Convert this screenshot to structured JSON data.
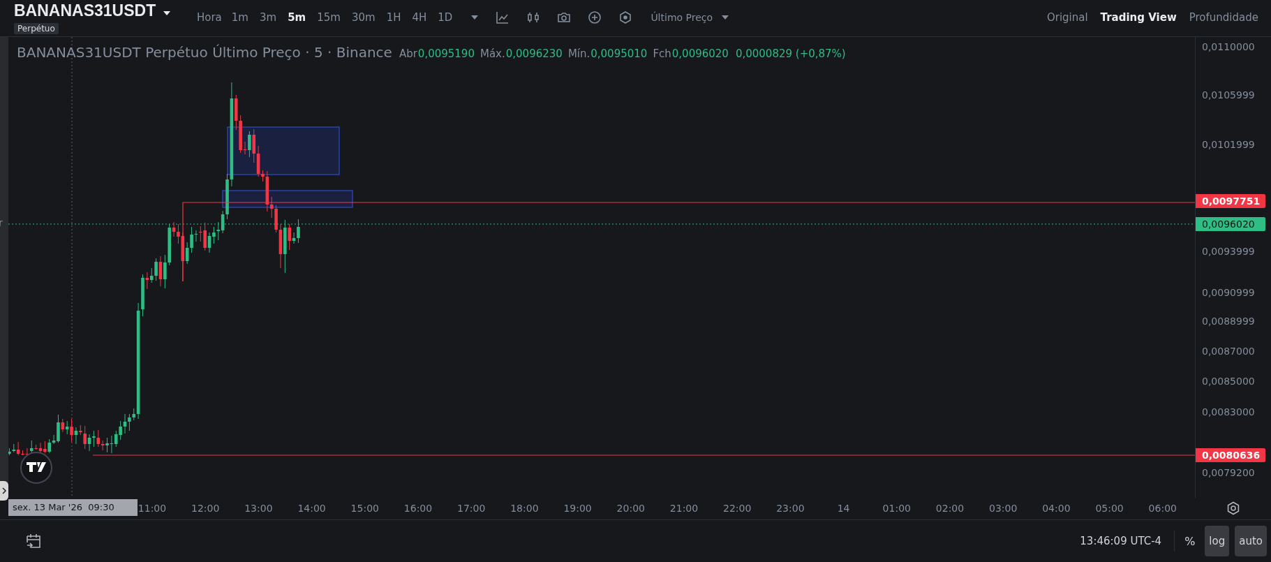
{
  "header": {
    "symbol": "BANANAS31USDT",
    "badge": "Perpétuo",
    "interval_label": "Hora",
    "intervals": [
      {
        "label": "1m",
        "selected": false
      },
      {
        "label": "3m",
        "selected": false
      },
      {
        "label": "5m",
        "selected": true
      },
      {
        "label": "15m",
        "selected": false
      },
      {
        "label": "30m",
        "selected": false
      },
      {
        "label": "1H",
        "selected": false
      },
      {
        "label": "4H",
        "selected": false
      },
      {
        "label": "1D",
        "selected": false
      }
    ],
    "price_type": "Último Preço",
    "views": [
      {
        "label": "Original",
        "selected": false
      },
      {
        "label": "Trading View",
        "selected": true
      },
      {
        "label": "Profundidade",
        "selected": false
      }
    ]
  },
  "legend": {
    "title": "BANANAS31USDT Perpétuo Último Preço · 5 · Binance",
    "stats": [
      {
        "label": "Abr",
        "value": "0,0095190"
      },
      {
        "label": "Máx.",
        "value": "0,0096230"
      },
      {
        "label": "Mín.",
        "value": "0,0095010"
      },
      {
        "label": "Fch",
        "value": "0,0096020"
      }
    ],
    "change": "0,0000829 (+0,87%)"
  },
  "left_edge_text": "r",
  "price_axis": {
    "ticks": [
      "0,0110000",
      "0,0105999",
      "0,0101999",
      "0,0093999",
      "0,0090999",
      "0,0088999",
      "0,0087000",
      "0,0085000",
      "0,0083000",
      "0,0079200"
    ],
    "markers": [
      {
        "value": "0,0097751",
        "color": "#f23645"
      },
      {
        "value": "0,0096020",
        "color": "#2ebd85"
      },
      {
        "value": "0,0080636",
        "color": "#f23645"
      }
    ]
  },
  "time_axis": {
    "crosshair_label": "sex. 13 Mar '26  09:30",
    "ticks": [
      "11:00",
      "12:00",
      "13:00",
      "14:00",
      "15:00",
      "16:00",
      "17:00",
      "18:00",
      "19:00",
      "20:00",
      "21:00",
      "22:00",
      "23:00",
      "14",
      "01:00",
      "02:00",
      "03:00",
      "04:00",
      "05:00",
      "06:00"
    ]
  },
  "bottom_bar": {
    "clock": "13:46:09 UTC-4",
    "percent": "%",
    "scale_buttons": [
      "log",
      "auto"
    ]
  }
}
